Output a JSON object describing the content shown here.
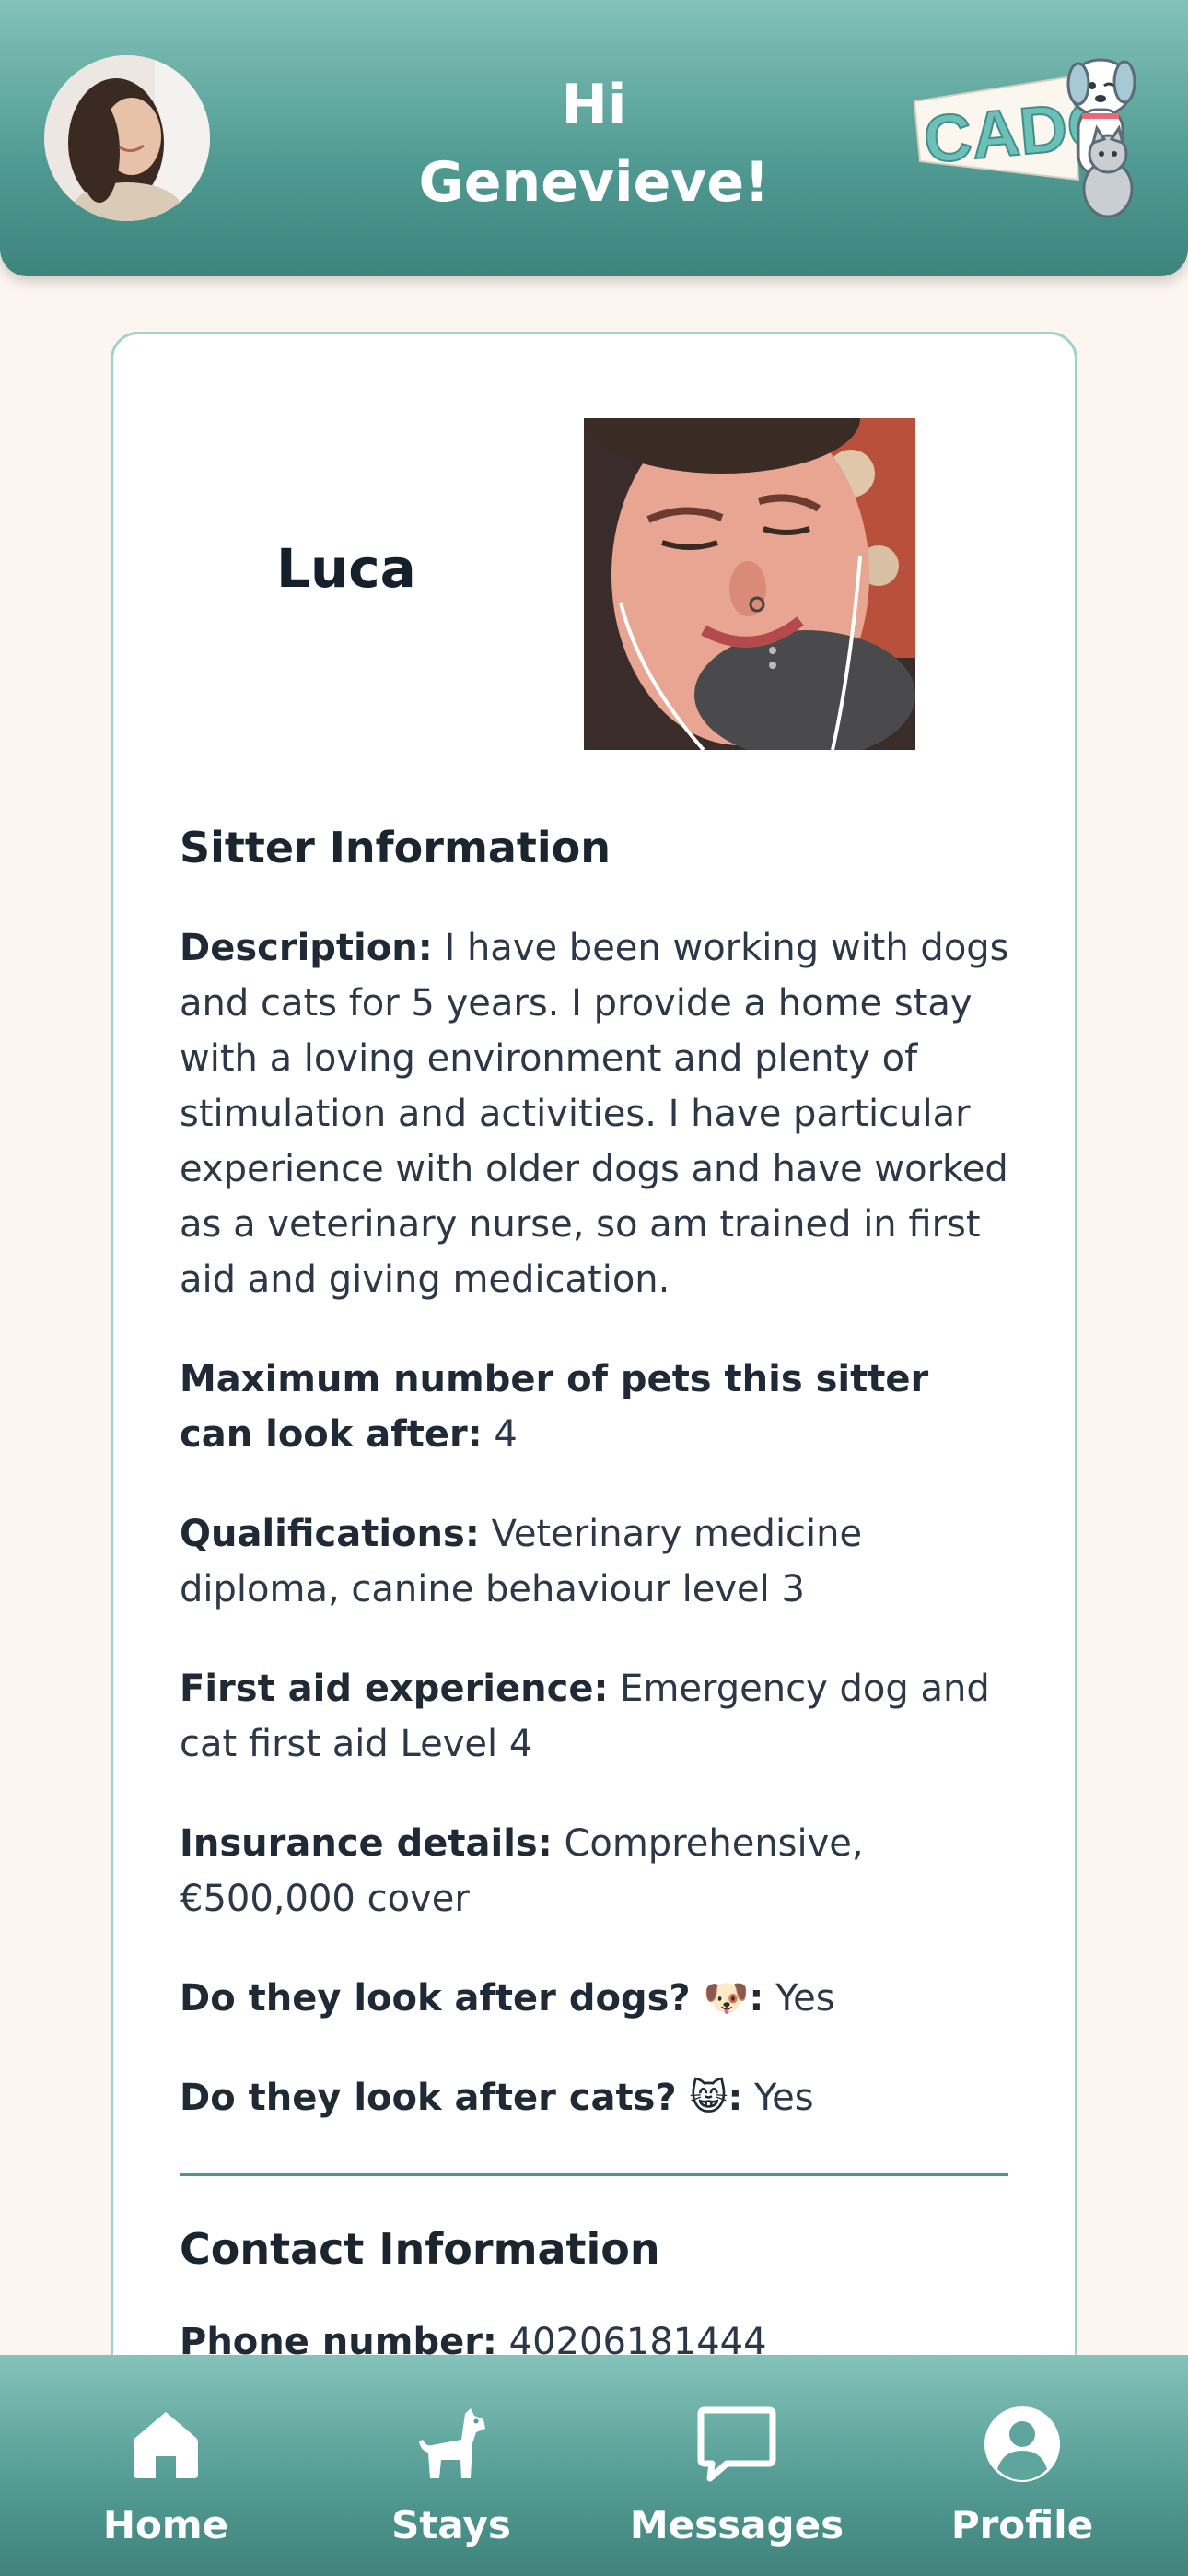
{
  "header": {
    "greeting_line1": "Hi",
    "greeting_line2": "Genevieve!",
    "logo_text": "CADO"
  },
  "sitter": {
    "name": "Luca"
  },
  "sitter_info": {
    "title": "Sitter Information",
    "description_label": "Description:",
    "description_value": "I have been working with dogs and cats for 5 years. I provide a home stay with a loving environment and plenty of stimulation and activities. I have particular experience with older dogs and have worked as a veterinary nurse, so am trained in first aid and giving medication.",
    "max_pets_label": "Maximum number of pets this sitter can look after:",
    "max_pets_value": "4",
    "qualifications_label": "Qualifications:",
    "qualifications_value": "Veterinary medicine diploma, canine behaviour level 3",
    "first_aid_label": "First aid experience:",
    "first_aid_value": "Emergency dog and cat first aid Level 4",
    "insurance_label": "Insurance details:",
    "insurance_value": "Comprehensive, €500,000 cover",
    "dogs_label": "Do they look after dogs?",
    "dogs_emoji": "🐶",
    "dogs_colon": ":",
    "dogs_value": "Yes",
    "cats_label": "Do they look after cats?",
    "cats_emoji": "😸",
    "cats_colon": ":",
    "cats_value": "Yes"
  },
  "contact_info": {
    "title": "Contact Information",
    "phone_label": "Phone number:",
    "phone_value": "40206181444"
  },
  "nav": {
    "items": [
      {
        "label": "Home",
        "icon": "home-icon"
      },
      {
        "label": "Stays",
        "icon": "dog-icon"
      },
      {
        "label": "Messages",
        "icon": "message-icon"
      },
      {
        "label": "Profile",
        "icon": "profile-icon"
      }
    ]
  },
  "colors": {
    "header_teal": "#4f9a92",
    "header_teal_light": "#83c2b9",
    "card_border": "#9fd2c9",
    "divider": "#4e958c",
    "page_background": "#fdf5f0"
  }
}
